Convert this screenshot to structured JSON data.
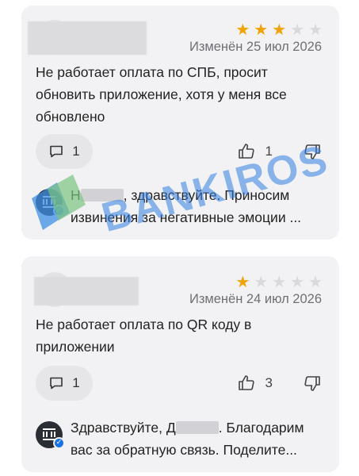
{
  "reviews": [
    {
      "rating": 3,
      "date": "Изменён 25 июл 2026",
      "text": "Не работает оплата по СПБ, просит обновить приложение, хотя у меня все обновлено",
      "comments_count": "1",
      "likes_count": "1",
      "reply_lead": "Н",
      "reply_rest": ", здравствуйте. Приносим",
      "reply_line2": "извинения за негативные эмоции ..."
    },
    {
      "rating": 1,
      "date": "Изменён 24 июл 2026",
      "text": "Не работает оплата по QR коду в приложении",
      "comments_count": "1",
      "likes_count": "3",
      "reply_lead": "Здравствуйте, Д",
      "reply_rest": ". Благодарим",
      "reply_line2": "вас за обратную связь. Поделите..."
    }
  ],
  "watermark": {
    "text": "BANKIROS",
    "color": "#2f7de1"
  },
  "colors": {
    "star_on": "#f5a200",
    "star_off": "#d9d9dc",
    "card_bg": "#f2f2f4"
  },
  "icons": [
    "comment-icon",
    "thumbs-up-icon",
    "thumbs-down-icon",
    "star-icon",
    "bank-logo-icon",
    "verified-icon"
  ]
}
